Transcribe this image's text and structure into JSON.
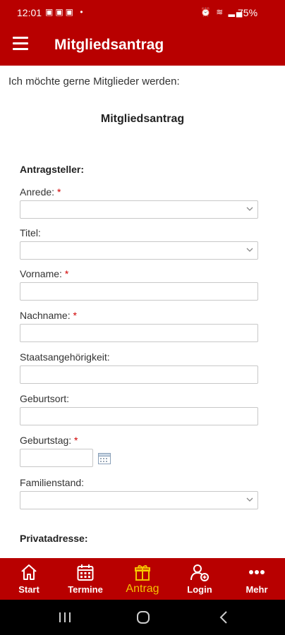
{
  "status_bar": {
    "time": "12:01",
    "battery": "75%",
    "left_icons": [
      "gallery-icon",
      "image-icon",
      "image-icon",
      "dot-icon"
    ],
    "right_icons": [
      "alarm-icon",
      "wifi-icon",
      "signal-icon",
      "battery-icon"
    ]
  },
  "app_bar": {
    "title": "Mitgliedsantrag",
    "menu_icon": "hamburger-icon"
  },
  "content": {
    "intro": "Ich möchte gerne Mitglieder werden:",
    "form_title": "Mitgliedsantrag",
    "section_applicant": "Antragsteller:",
    "section_address": "Privatadresse:",
    "fields": {
      "anrede": {
        "label": "Anrede:",
        "required": "*",
        "value": ""
      },
      "titel": {
        "label": "Titel:",
        "value": ""
      },
      "vorname": {
        "label": "Vorname:",
        "required": "*",
        "value": ""
      },
      "nachname": {
        "label": "Nachname:",
        "required": "*",
        "value": ""
      },
      "staat": {
        "label": "Staatsangehörigkeit:",
        "value": ""
      },
      "geburtsort": {
        "label": "Geburtsort:",
        "value": ""
      },
      "geburtstag": {
        "label": "Geburtstag:",
        "required": "*",
        "value": ""
      },
      "familienstand": {
        "label": "Familienstand:",
        "value": ""
      }
    }
  },
  "bottom_nav": {
    "items": [
      {
        "label": "Start",
        "icon": "home-icon"
      },
      {
        "label": "Termine",
        "icon": "calendar-icon"
      },
      {
        "label": "Antrag",
        "icon": "gift-icon",
        "active": true
      },
      {
        "label": "Login",
        "icon": "user-add-icon"
      },
      {
        "label": "Mehr",
        "icon": "more-icon"
      }
    ]
  },
  "colors": {
    "brand": "#b80000",
    "active": "#f5c400",
    "required": "#d00000"
  }
}
